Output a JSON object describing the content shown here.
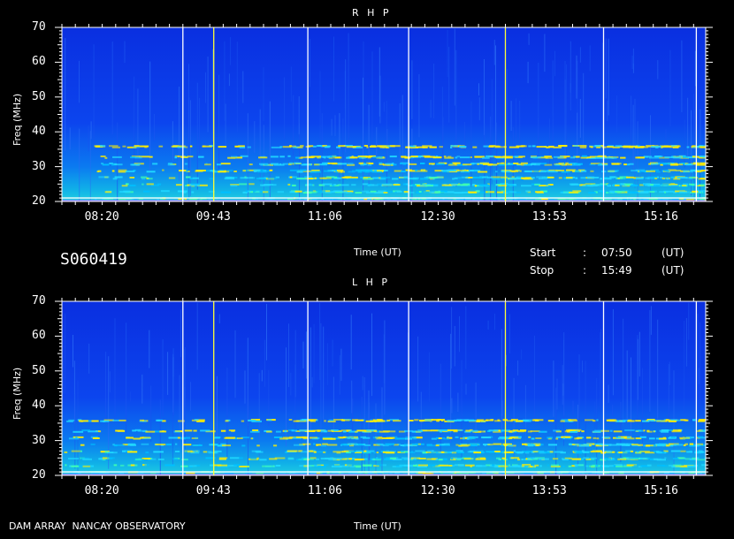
{
  "observation_id": "S060419",
  "footer": {
    "observatory": "DAM ARRAY  NANCAY OBSERVATORY"
  },
  "time_info": {
    "start_label": "Start",
    "start_value": "07:50",
    "stop_label": "Stop",
    "stop_value": "15:49",
    "separator": ":",
    "unit": "(UT)"
  },
  "colors": {
    "vertical_marker_white": "#ffffff",
    "vertical_marker_yellow": "#ffff33",
    "background_low": "#0a30e6",
    "emission_mid": "#00c8ff",
    "emission_high": "#ffee00"
  },
  "chart_data": [
    {
      "type": "heatmap",
      "title": "R H P",
      "xlabel": "Time (UT)",
      "ylabel": "Freq (MHz)",
      "ylim": [
        20,
        70
      ],
      "x_range": [
        "07:50",
        "15:49"
      ],
      "x_ticks": [
        "08:20",
        "09:43",
        "11:06",
        "12:30",
        "13:53",
        "15:16"
      ],
      "y_ticks": [
        20,
        30,
        40,
        50,
        60,
        70
      ],
      "vertical_markers": [
        {
          "time": "09:20",
          "color": "white"
        },
        {
          "time": "09:43",
          "color": "yellow"
        },
        {
          "time": "10:53",
          "color": "white"
        },
        {
          "time": "12:08",
          "color": "white"
        },
        {
          "time": "13:20",
          "color": "yellow"
        },
        {
          "time": "14:33",
          "color": "white"
        },
        {
          "time": "15:42",
          "color": "white"
        }
      ],
      "emission_bands_mhz": [
        21,
        23,
        25,
        27,
        29,
        31,
        33,
        36
      ]
    },
    {
      "type": "heatmap",
      "title": "L H P",
      "xlabel": "Time (UT)",
      "ylabel": "Freq (MHz)",
      "ylim": [
        20,
        70
      ],
      "x_range": [
        "07:50",
        "15:49"
      ],
      "x_ticks": [
        "08:20",
        "09:43",
        "11:06",
        "12:30",
        "13:53",
        "15:16"
      ],
      "y_ticks": [
        20,
        30,
        40,
        50,
        60,
        70
      ],
      "vertical_markers": [
        {
          "time": "09:20",
          "color": "white"
        },
        {
          "time": "09:43",
          "color": "yellow"
        },
        {
          "time": "10:53",
          "color": "white"
        },
        {
          "time": "12:08",
          "color": "white"
        },
        {
          "time": "13:20",
          "color": "yellow"
        },
        {
          "time": "14:33",
          "color": "white"
        },
        {
          "time": "15:42",
          "color": "white"
        }
      ],
      "emission_bands_mhz": [
        21,
        23,
        25,
        27,
        29,
        31,
        33,
        36
      ]
    }
  ]
}
